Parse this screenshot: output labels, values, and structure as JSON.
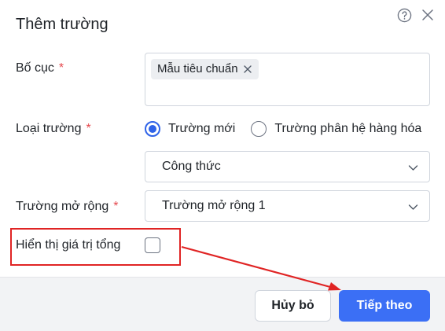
{
  "dialog": {
    "title": "Thêm trường",
    "help_icon": "question-circle-icon",
    "close_icon": "close-icon"
  },
  "layout_field": {
    "label": "Bố cục",
    "required_mark": "*",
    "tags": [
      "Mẫu tiêu chuẩn"
    ]
  },
  "field_type": {
    "label": "Loại trường",
    "required_mark": "*",
    "options": [
      "Trường mới",
      "Trường phân hệ hàng hóa"
    ],
    "selected": "Trường mới",
    "select_value": "Công thức"
  },
  "extended_field": {
    "label": "Trường mở rộng",
    "required_mark": "*",
    "select_value": "Trường mở rộng 1"
  },
  "show_total": {
    "label": "Hiển thị giá trị tổng",
    "checked": false
  },
  "footer": {
    "cancel_label": "Hủy bỏ",
    "next_label": "Tiếp theo"
  },
  "colors": {
    "primary": "#3b6ff5",
    "required": "#e5484d",
    "annotation": "#e02424"
  }
}
